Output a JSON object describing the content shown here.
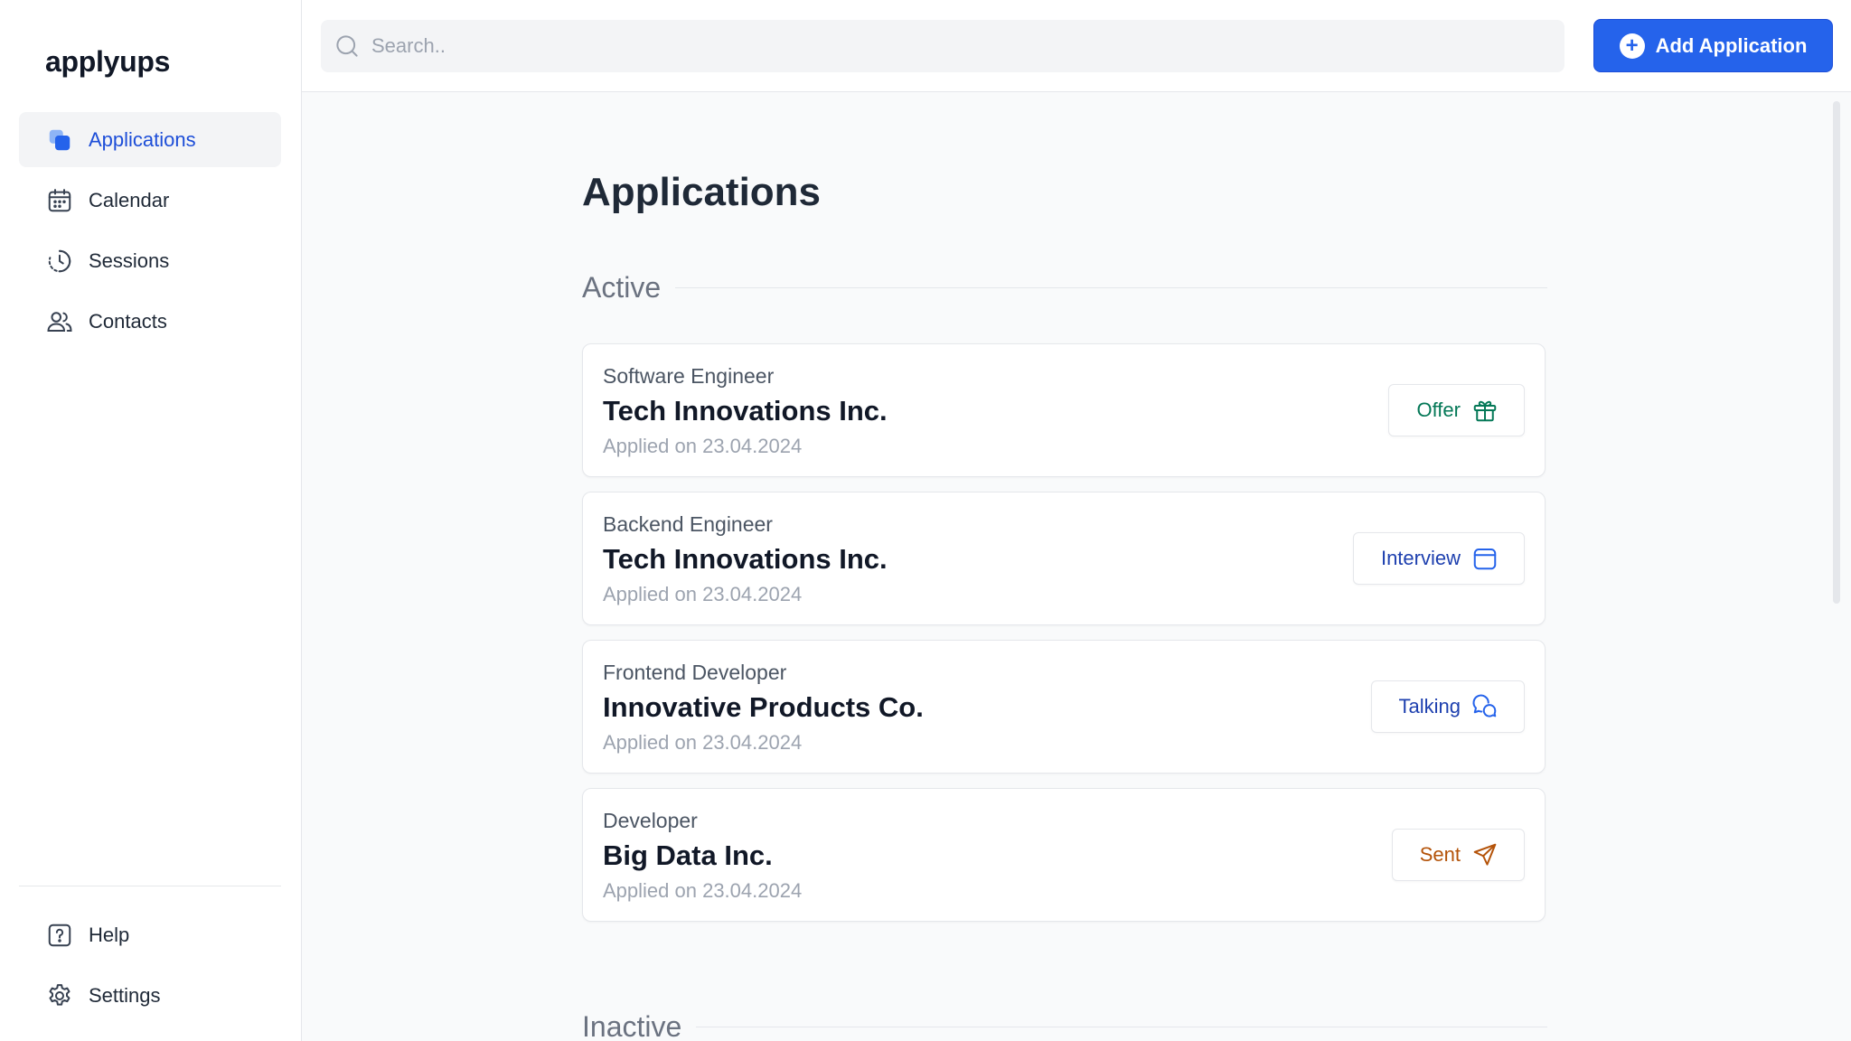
{
  "app": {
    "name": "applyups"
  },
  "sidebar": {
    "items": [
      {
        "label": "Applications",
        "icon": "applications-icon",
        "active": true
      },
      {
        "label": "Calendar",
        "icon": "calendar-icon",
        "active": false
      },
      {
        "label": "Sessions",
        "icon": "history-icon",
        "active": false
      },
      {
        "label": "Contacts",
        "icon": "users-icon",
        "active": false
      }
    ],
    "bottom_items": [
      {
        "label": "Help",
        "icon": "help-icon"
      },
      {
        "label": "Settings",
        "icon": "gear-icon"
      }
    ]
  },
  "search": {
    "placeholder": "Search..",
    "value": ""
  },
  "toolbar": {
    "add_label": "Add Application"
  },
  "main": {
    "title": "Applications",
    "sections": {
      "active": {
        "label": "Active"
      },
      "inactive": {
        "label": "Inactive"
      }
    },
    "applications": [
      {
        "role": "Software Engineer",
        "company": "Tech Innovations Inc.",
        "applied": "Applied on 23.04.2024",
        "status": "Offer",
        "status_icon": "gift-icon",
        "status_color": "#047857"
      },
      {
        "role": "Backend Engineer",
        "company": "Tech Innovations Inc.",
        "applied": "Applied on 23.04.2024",
        "status": "Interview",
        "status_icon": "calendar-icon",
        "status_color": "#1e40af"
      },
      {
        "role": "Frontend Developer",
        "company": "Innovative Products Co.",
        "applied": "Applied on 23.04.2024",
        "status": "Talking",
        "status_icon": "chat-icon",
        "status_color": "#1e40af"
      },
      {
        "role": "Developer",
        "company": "Big Data Inc.",
        "applied": "Applied on 23.04.2024",
        "status": "Sent",
        "status_icon": "send-icon",
        "status_color": "#b45309"
      }
    ]
  },
  "colors": {
    "accent": "#2563eb",
    "active_nav_text": "#1d4ed8",
    "background": "#f9fafb"
  }
}
